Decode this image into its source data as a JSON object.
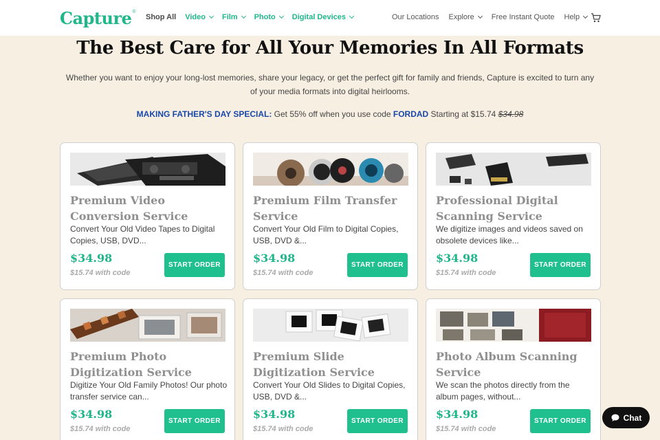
{
  "brand": {
    "logo_text": "Capture",
    "logo_mark": "®",
    "accent_color": "#1fb789",
    "promo_color": "#1848a8"
  },
  "nav": {
    "left": [
      {
        "label": "Shop All",
        "style": "plain",
        "dropdown": false
      },
      {
        "label": "Video",
        "style": "green",
        "dropdown": true
      },
      {
        "label": "Film",
        "style": "green",
        "dropdown": true
      },
      {
        "label": "Photo",
        "style": "green",
        "dropdown": true
      },
      {
        "label": "Digital Devices",
        "style": "green",
        "dropdown": true
      }
    ],
    "right": [
      {
        "label": "Our Locations",
        "dropdown": false
      },
      {
        "label": "Explore",
        "dropdown": true
      },
      {
        "label": "Free Instant Quote",
        "dropdown": false
      },
      {
        "label": "Help",
        "dropdown": true
      }
    ],
    "cart_icon": "cart-icon"
  },
  "hero": {
    "title": "The Best Care for All Your Memories In All Formats",
    "subtitle": "Whether you want to enjoy your long-lost memories, share your legacy, or get the perfect gift for family and friends, Capture is excited to turn any of your media formats into digital heirlooms."
  },
  "promo": {
    "label": "MAKING FATHER'S DAY SPECIAL:",
    "text_before_code": " Get 55% off when you use code ",
    "code": "FORDAD",
    "text_after_code": " Starting at $15.74 ",
    "old_price": "$34.98"
  },
  "cards": [
    {
      "title": "Premium Video Conversion Service",
      "desc": "Convert Your Old Video Tapes to Digital Copies, USB, DVD...",
      "price": "$34.98",
      "code_price": "$15.74 with code",
      "button": "START ORDER",
      "image": "vhs-tapes-image"
    },
    {
      "title": "Premium Film Transfer Service",
      "desc": "Convert Your Old Film to Digital Copies, USB, DVD &...",
      "price": "$34.98",
      "code_price": "$15.74 with code",
      "button": "START ORDER",
      "image": "film-reels-image"
    },
    {
      "title": "Professional Digital Scanning Service",
      "desc": "We digitize images and videos saved on obsolete devices like...",
      "price": "$34.98",
      "code_price": "$15.74 with code",
      "button": "START ORDER",
      "image": "memory-cards-image"
    },
    {
      "title": "Premium Photo Digitization Service",
      "desc": "Digitize Your Old Family Photos! Our photo transfer service can...",
      "price": "$34.98",
      "code_price": "$15.74 with code",
      "button": "START ORDER",
      "image": "photo-negatives-image"
    },
    {
      "title": "Premium Slide Digitization Service",
      "desc": "Convert Your Old Slides to Digital Copies, USB, DVD &...",
      "price": "$34.98",
      "code_price": "$15.74 with code",
      "button": "START ORDER",
      "image": "slides-image"
    },
    {
      "title": "Photo Album Scanning Service",
      "desc": "We scan the photos directly from the album pages, without...",
      "price": "$34.98",
      "code_price": "$15.74 with code",
      "button": "START ORDER",
      "image": "photo-album-image"
    }
  ],
  "chat": {
    "label": "Chat",
    "icon": "chat-bubble-icon"
  }
}
